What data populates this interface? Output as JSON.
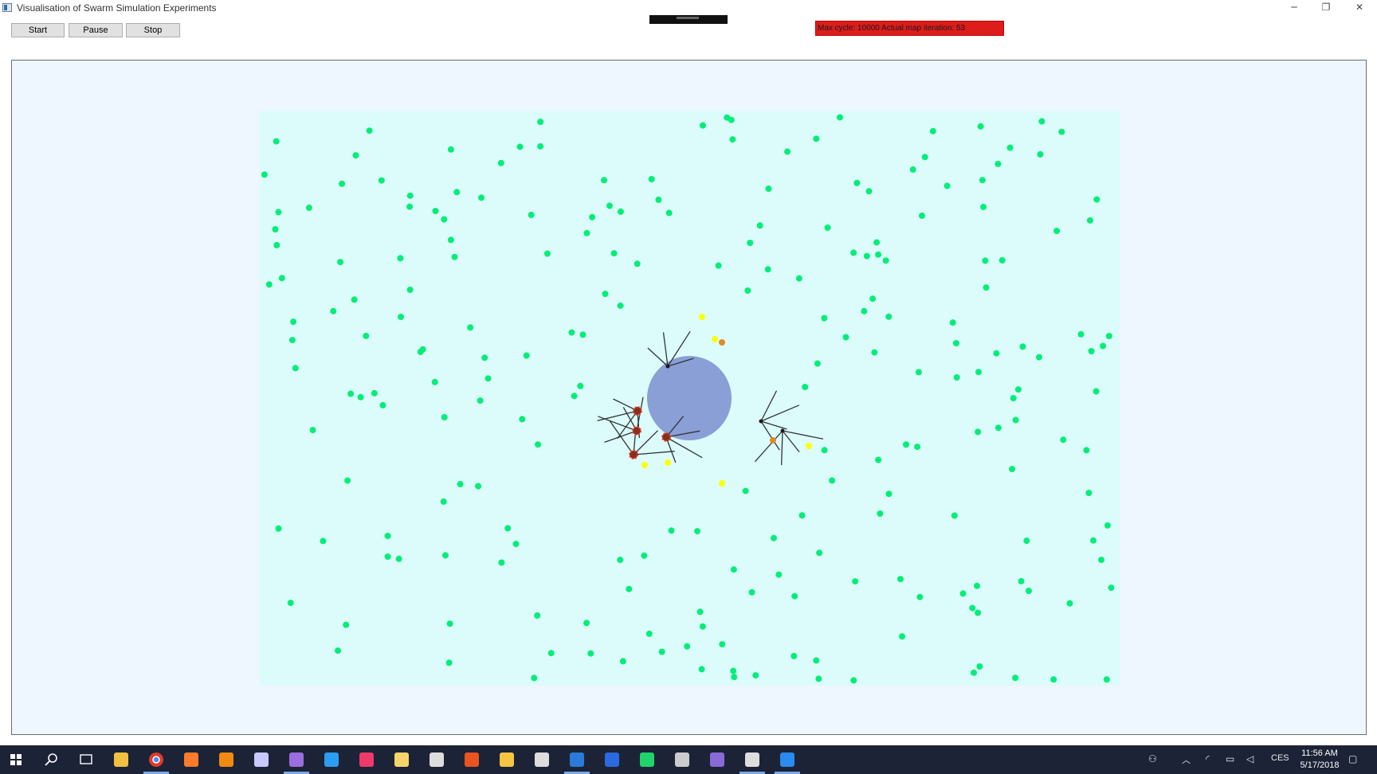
{
  "window": {
    "title": "Visualisation of Swarm Simulation Experiments"
  },
  "window_controls": {
    "minimize": "─",
    "restore": "❐",
    "close": "✕"
  },
  "toolbar": {
    "start_label": "Start",
    "pause_label": "Pause",
    "stop_label": "Stop"
  },
  "status": {
    "text": "Max cycle: 10000 Actual map iteration: 53",
    "color": "#dd1c1c"
  },
  "map": {
    "background": "#dcfcfc",
    "food": {
      "color": "#00ee77",
      "count": 220
    },
    "nest": {
      "color": "#8a9fd6"
    },
    "yellow_items": {
      "color": "#ffff00",
      "count": 6
    },
    "orange_items": {
      "color": "#e08a2e",
      "count": 2
    },
    "agents": [
      {
        "color": "#1a1a1a"
      },
      {
        "color": "#1a1a1a"
      },
      {
        "color": "#1a1a1a"
      },
      {
        "color": "#8b2e1a"
      },
      {
        "color": "#8b2e1a"
      },
      {
        "color": "#8b2e1a"
      },
      {
        "color": "#8b2e1a"
      }
    ]
  },
  "taskbar": {
    "apps": [
      "start-icon",
      "search-icon",
      "task-view-icon",
      "git-icon",
      "chrome-icon",
      "firefox-icon",
      "vlc-icon",
      "app-icon",
      "visual-studio-icon",
      "vscode-icon",
      "intellij-icon",
      "sticky-notes-icon",
      "terminal-icon",
      "ubuntu-icon",
      "file-explorer-icon",
      "terminal-icon",
      "powershell-icon",
      "save-icon",
      "pycharm-icon",
      "app-icon",
      "app-icon",
      "terminal-icon",
      "simulation-app-icon"
    ],
    "tray": {
      "language": "CES",
      "time": "11:56 AM",
      "date": "5/17/2018"
    }
  }
}
